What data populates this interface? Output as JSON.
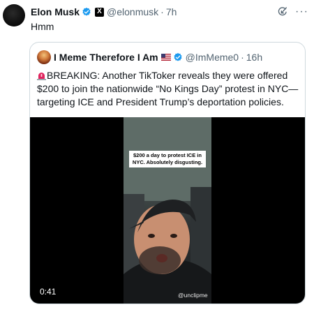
{
  "post": {
    "author_name": "Elon Musk",
    "author_handle": "@elonmusk",
    "separator": "·",
    "time": "7h",
    "text": "Hmm",
    "icons": {
      "verified": "verified-badge-icon",
      "affiliate": "x-affiliate-badge-icon",
      "grok": "grok-icon",
      "more": "more-options-icon"
    },
    "more_glyph": "···",
    "x_badge_glyph": "X"
  },
  "quote": {
    "author_name": "I Meme Therefore I Am",
    "flag": "us-flag-icon",
    "author_handle": "@ImMeme0",
    "separator": "·",
    "time": "16h",
    "text": "BREAKING: Another TikToker reveals they were offered $200 to join the nationwide “No Kings Day” protest in NYC—targeting ICE and President Trump’s deportation policies.",
    "video": {
      "caption": "$200 a day to protest ICE in NYC. Absolutely disgusting.",
      "watermark": "@unclipme",
      "duration": "0:41"
    }
  },
  "colors": {
    "verified_blue": "#1d9bf0",
    "text_primary": "#0f1419",
    "text_secondary": "#536471",
    "border": "#cfd9de",
    "siren_red": "#e0245e"
  }
}
